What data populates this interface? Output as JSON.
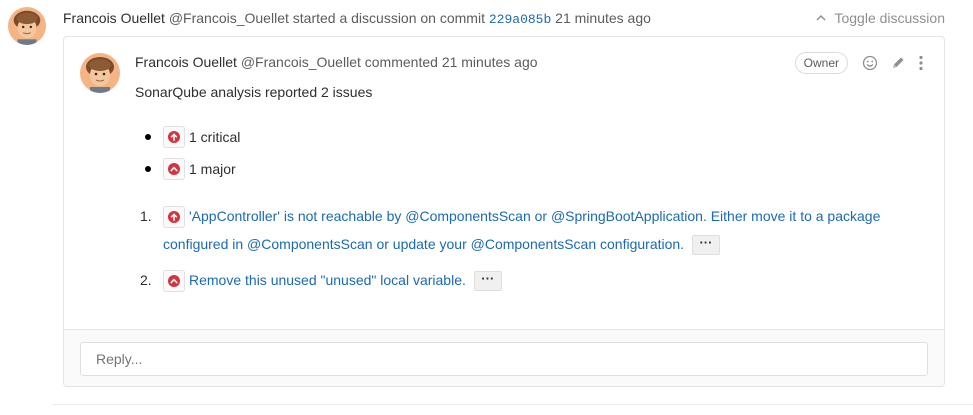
{
  "discussion": {
    "author_name": "Francois Ouellet",
    "author_handle": "@Francois_Ouellet",
    "action_text": "started a discussion on commit",
    "commit_sha": "229a085b",
    "time_ago": "21 minutes ago",
    "toggle_label": "Toggle discussion",
    "toggle_icon": "chevron-up-icon"
  },
  "note": {
    "author_name": "Francois Ouellet",
    "author_handle": "@Francois_Ouellet",
    "action_text": "commented",
    "time_ago": "21 minutes ago",
    "role_badge": "Owner",
    "action_icons": [
      "smiley-icon",
      "pencil-icon",
      "more-vertical-icon"
    ],
    "summary": "SonarQube analysis reported 2 issues",
    "severity_counts": [
      {
        "label": "1 critical",
        "icon": "critical-arrow-up-icon"
      },
      {
        "label": "1 major",
        "icon": "major-chevron-up-icon"
      }
    ],
    "issues": [
      {
        "number": "1.",
        "icon": "critical-arrow-up-icon",
        "text": "'AppController' is not reachable by @ComponentsScan or @SpringBootApplication. Either move it to a package configured in @ComponentsScan or update your @ComponentsScan configuration.",
        "more_label": "···"
      },
      {
        "number": "2.",
        "icon": "major-chevron-up-icon",
        "text": "Remove this unused \"unused\" local variable.",
        "more_label": "···"
      }
    ]
  },
  "reply": {
    "placeholder": "Reply..."
  },
  "colors": {
    "link": "#1b69b6",
    "severity_red": "#d4333f",
    "muted": "#8f8f8f"
  }
}
